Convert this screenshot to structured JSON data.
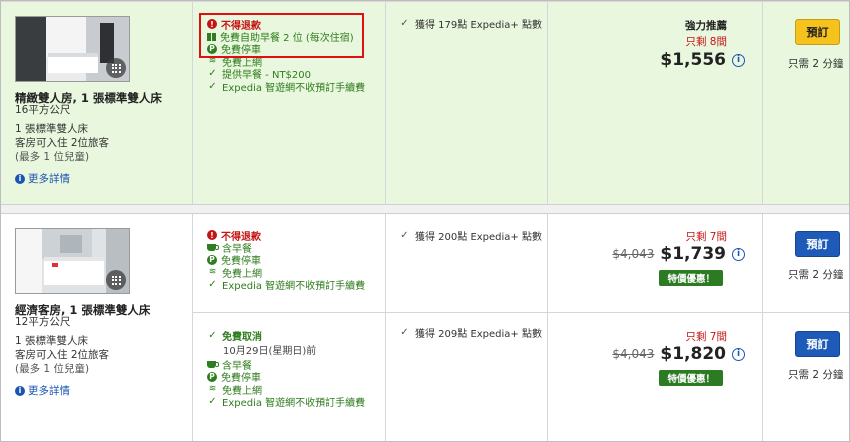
{
  "rooms": [
    {
      "name": "精緻雙人房, 1 張標準雙人床",
      "size": "16平方公尺",
      "bed": "1 張標準雙人床",
      "occupancy": "客房可入住 2位旅客",
      "children": "(最多 1 位兒童)",
      "more_label": "更多詳情",
      "options": [
        {
          "features": [
            {
              "icon": "alert-icon",
              "text": "不得退款",
              "style": "red"
            },
            {
              "icon": "gift-icon",
              "text": "免費自助早餐 2 位 (每次住宿)",
              "style": "green"
            },
            {
              "icon": "parking-icon",
              "text": "免費停車",
              "style": "green"
            },
            {
              "icon": "wifi-icon",
              "text": "免費上網",
              "style": "green"
            },
            {
              "icon": "check-icon",
              "text": "提供早餐 - NT$200",
              "style": "green"
            },
            {
              "icon": "check-icon",
              "text": "Expedia 智遊網不收預訂手續費",
              "style": "green"
            }
          ],
          "points": "獲得 179點 Expedia+ 點數",
          "recommend": "強力推薦",
          "rooms_left": "只剩 8間",
          "old_price": "",
          "price": "$1,556",
          "deal": "",
          "book_label": "預訂",
          "book_color": "#f6c21e",
          "steps": "只需 2 分鐘"
        }
      ]
    },
    {
      "name": "經濟客房, 1 張標準雙人床",
      "size": "12平方公尺",
      "bed": "1 張標準雙人床",
      "occupancy": "客房可入住 2位旅客",
      "children": "(最多 1 位兒童)",
      "more_label": "更多詳情",
      "options": [
        {
          "features": [
            {
              "icon": "alert-icon",
              "text": "不得退款",
              "style": "red"
            },
            {
              "icon": "coffee-icon",
              "text": "含早餐",
              "style": "green"
            },
            {
              "icon": "parking-icon",
              "text": "免費停車",
              "style": "green"
            },
            {
              "icon": "wifi-icon",
              "text": "免費上網",
              "style": "green"
            },
            {
              "icon": "check-icon",
              "text": "Expedia 智遊網不收預訂手續費",
              "style": "green"
            }
          ],
          "points": "獲得 200點 Expedia+ 點數",
          "recommend": "",
          "rooms_left": "只剩 7間",
          "old_price": "$4,043",
          "price": "$1,739",
          "deal": "特價優惠！",
          "book_label": "預訂",
          "book_color": "#1e5bb8",
          "steps": "只需 2 分鐘"
        },
        {
          "features": [
            {
              "icon": "check-icon",
              "text": "免費取消",
              "style": "green-bold"
            },
            {
              "icon": "",
              "text": "10月29日(星期日)前",
              "style": "sub"
            },
            {
              "icon": "coffee-icon",
              "text": "含早餐",
              "style": "green"
            },
            {
              "icon": "parking-icon",
              "text": "免費停車",
              "style": "green"
            },
            {
              "icon": "wifi-icon",
              "text": "免費上網",
              "style": "green"
            },
            {
              "icon": "check-icon",
              "text": "Expedia 智遊網不收預訂手續費",
              "style": "green"
            }
          ],
          "points": "獲得 209點 Expedia+ 點數",
          "recommend": "",
          "rooms_left": "只剩 7間",
          "old_price": "$4,043",
          "price": "$1,820",
          "deal": "特價優惠！",
          "book_label": "預訂",
          "book_color": "#1e5bb8",
          "steps": "只需 2 分鐘"
        }
      ]
    }
  ],
  "highlight_color": "#e01010"
}
